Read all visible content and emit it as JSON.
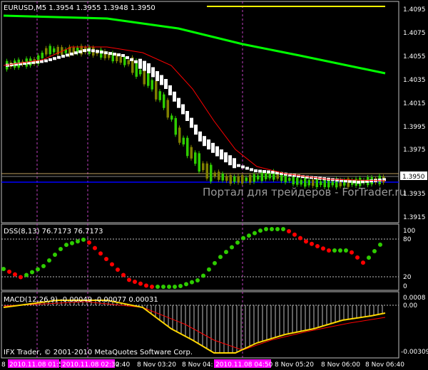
{
  "main_panel": {
    "symbol_label": "EURUSD,M5  1.3954 1.3955 1.3948 1.3950",
    "watermark": "Портал для трейдеров - ForTrader.ru",
    "price_ticks": [
      "1.4095",
      "1.4075",
      "1.4055",
      "1.4035",
      "1.4015",
      "1.3995",
      "1.3975",
      "1.3935",
      "1.3915"
    ],
    "current_price": "1.3950"
  },
  "dss_panel": {
    "label": "DSS(8,13) 76.7173 76.7173",
    "ticks": [
      "100",
      "80",
      "20",
      "0"
    ]
  },
  "macd_panel": {
    "label": "MACD(12,26,9) -0.00049 -0.00077 0.00031",
    "ticks": [
      "0.0008",
      "0.00",
      "-0.00309"
    ],
    "copyright": "IFX Trader, © 2001-2010 MetaQuotes Software Corp."
  },
  "time_axis": {
    "labels": [
      "8 Nov 03:20",
      "8 Nov 04:",
      "8 Nov 05:20",
      "8 Nov 06:00",
      "8 Nov 06:40"
    ],
    "left_char": "8",
    "highlights": [
      "2010.11.08 01:5",
      "2010.11.08 02:30",
      "2010.11.08 04:50"
    ],
    "partial": "2:40"
  },
  "colors": {
    "bull": "#2ecc00",
    "bear": "#808000",
    "ma_green": "#00ff00",
    "ma_red": "#ff0000",
    "highlight_bg": "#ff00ff"
  }
}
